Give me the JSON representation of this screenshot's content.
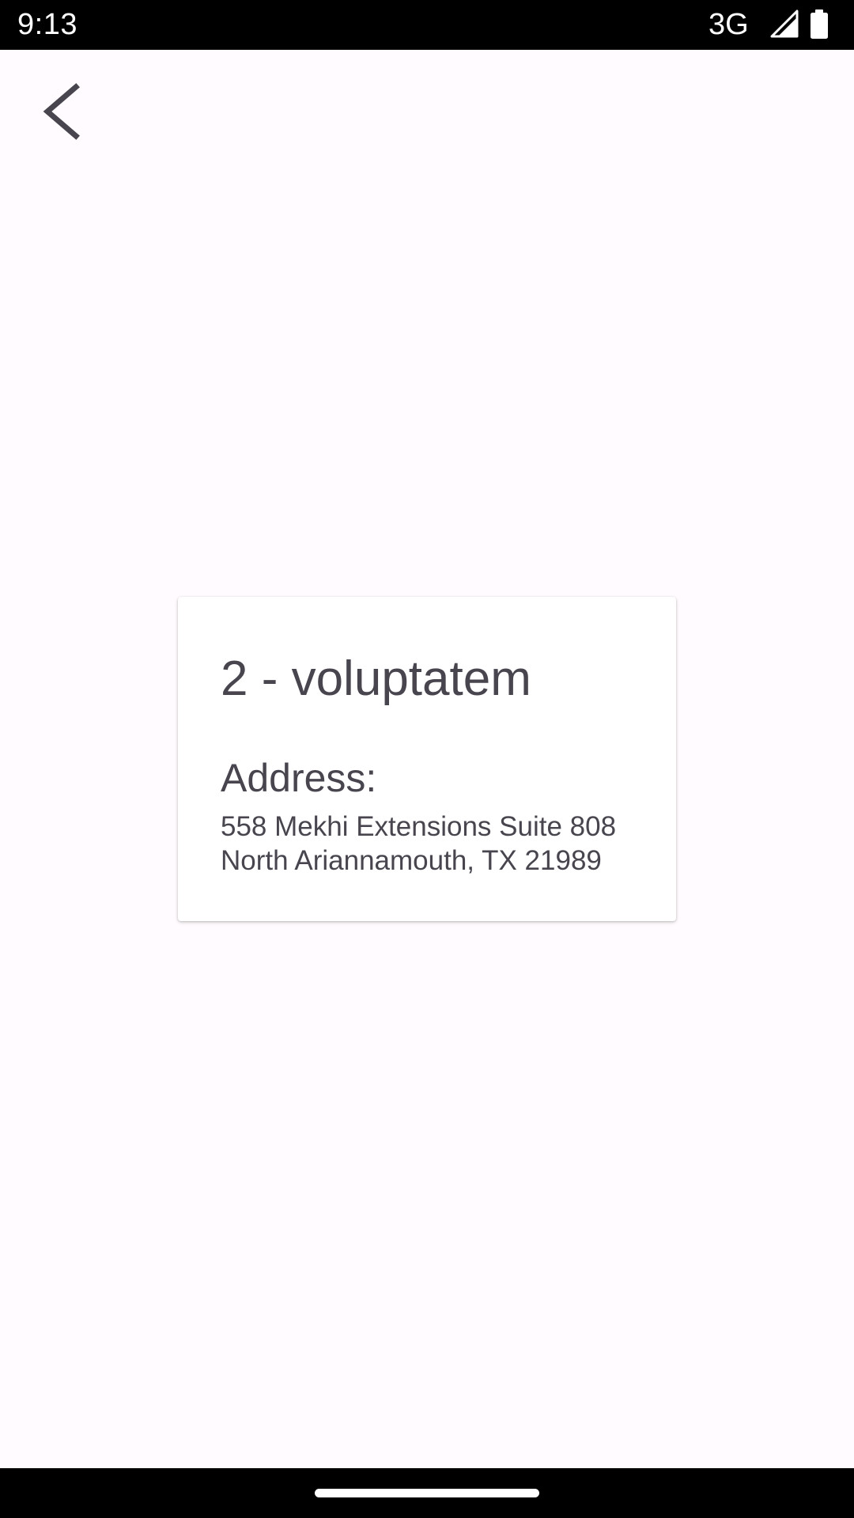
{
  "status_bar": {
    "time": "9:13",
    "network": "3G",
    "icons": [
      "signal-icon",
      "battery-icon"
    ]
  },
  "toolbar": {
    "back_icon": "back-arrow-icon"
  },
  "card": {
    "title": "2 - voluptatem",
    "address_label": "Address:",
    "address_line_1": "558 Mekhi Extensions Suite 808",
    "address_line_2": "North Ariannamouth, TX 21989"
  },
  "colors": {
    "background": "#fffbfe",
    "card_background": "#ffffff",
    "text": "#49454f",
    "system_bars": "#000000"
  }
}
